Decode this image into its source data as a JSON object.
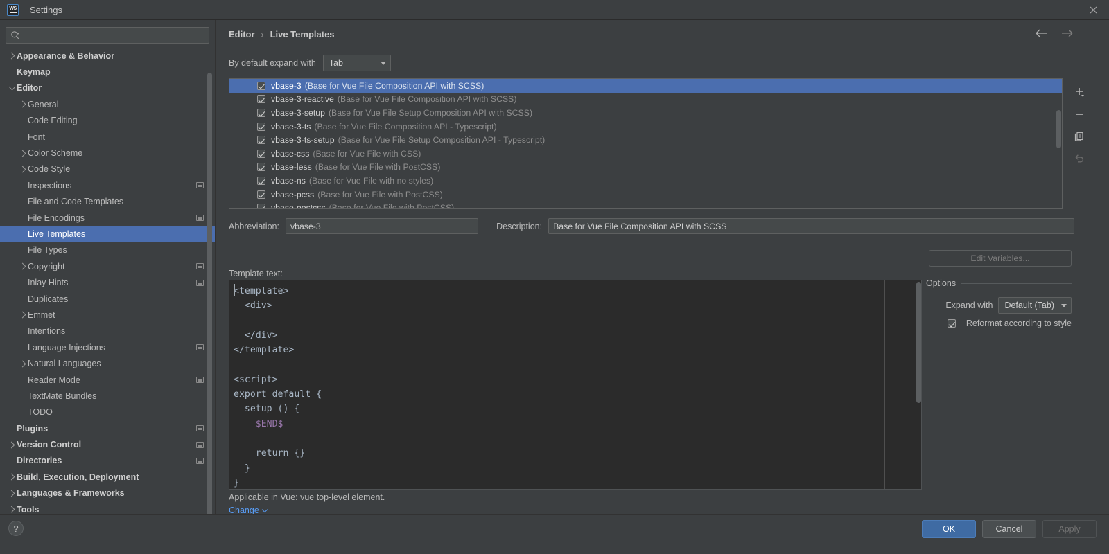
{
  "window": {
    "title": "Settings",
    "logo_text": "WS",
    "close_icon": "close-icon"
  },
  "search": {
    "placeholder": "",
    "value": "",
    "icon": "search-icon"
  },
  "sidebar": {
    "items": [
      {
        "label": "Appearance & Behavior",
        "level": 0,
        "arrow": "right",
        "bold": true,
        "mark": false,
        "selected": false
      },
      {
        "label": "Keymap",
        "level": 0,
        "arrow": "none",
        "bold": true,
        "mark": false,
        "selected": false
      },
      {
        "label": "Editor",
        "level": 0,
        "arrow": "down",
        "bold": true,
        "mark": false,
        "selected": false
      },
      {
        "label": "General",
        "level": 1,
        "arrow": "right",
        "bold": false,
        "mark": false,
        "selected": false
      },
      {
        "label": "Code Editing",
        "level": 1,
        "arrow": "none",
        "bold": false,
        "mark": false,
        "selected": false
      },
      {
        "label": "Font",
        "level": 1,
        "arrow": "none",
        "bold": false,
        "mark": false,
        "selected": false
      },
      {
        "label": "Color Scheme",
        "level": 1,
        "arrow": "right",
        "bold": false,
        "mark": false,
        "selected": false
      },
      {
        "label": "Code Style",
        "level": 1,
        "arrow": "right",
        "bold": false,
        "mark": false,
        "selected": false
      },
      {
        "label": "Inspections",
        "level": 1,
        "arrow": "none",
        "bold": false,
        "mark": true,
        "selected": false
      },
      {
        "label": "File and Code Templates",
        "level": 1,
        "arrow": "none",
        "bold": false,
        "mark": false,
        "selected": false
      },
      {
        "label": "File Encodings",
        "level": 1,
        "arrow": "none",
        "bold": false,
        "mark": true,
        "selected": false
      },
      {
        "label": "Live Templates",
        "level": 1,
        "arrow": "none",
        "bold": false,
        "mark": false,
        "selected": true
      },
      {
        "label": "File Types",
        "level": 1,
        "arrow": "none",
        "bold": false,
        "mark": false,
        "selected": false
      },
      {
        "label": "Copyright",
        "level": 1,
        "arrow": "right",
        "bold": false,
        "mark": true,
        "selected": false
      },
      {
        "label": "Inlay Hints",
        "level": 1,
        "arrow": "none",
        "bold": false,
        "mark": true,
        "selected": false
      },
      {
        "label": "Duplicates",
        "level": 1,
        "arrow": "none",
        "bold": false,
        "mark": false,
        "selected": false
      },
      {
        "label": "Emmet",
        "level": 1,
        "arrow": "right",
        "bold": false,
        "mark": false,
        "selected": false
      },
      {
        "label": "Intentions",
        "level": 1,
        "arrow": "none",
        "bold": false,
        "mark": false,
        "selected": false
      },
      {
        "label": "Language Injections",
        "level": 1,
        "arrow": "none",
        "bold": false,
        "mark": true,
        "selected": false
      },
      {
        "label": "Natural Languages",
        "level": 1,
        "arrow": "right",
        "bold": false,
        "mark": false,
        "selected": false
      },
      {
        "label": "Reader Mode",
        "level": 1,
        "arrow": "none",
        "bold": false,
        "mark": true,
        "selected": false
      },
      {
        "label": "TextMate Bundles",
        "level": 1,
        "arrow": "none",
        "bold": false,
        "mark": false,
        "selected": false
      },
      {
        "label": "TODO",
        "level": 1,
        "arrow": "none",
        "bold": false,
        "mark": false,
        "selected": false
      },
      {
        "label": "Plugins",
        "level": 0,
        "arrow": "none",
        "bold": true,
        "mark": true,
        "selected": false
      },
      {
        "label": "Version Control",
        "level": 0,
        "arrow": "right",
        "bold": true,
        "mark": true,
        "selected": false
      },
      {
        "label": "Directories",
        "level": 0,
        "arrow": "none",
        "bold": true,
        "mark": true,
        "selected": false
      },
      {
        "label": "Build, Execution, Deployment",
        "level": 0,
        "arrow": "right",
        "bold": true,
        "mark": false,
        "selected": false
      },
      {
        "label": "Languages & Frameworks",
        "level": 0,
        "arrow": "right",
        "bold": true,
        "mark": false,
        "selected": false
      },
      {
        "label": "Tools",
        "level": 0,
        "arrow": "right",
        "bold": true,
        "mark": false,
        "selected": false
      }
    ]
  },
  "breadcrumb": {
    "parent": "Editor",
    "separator": "›",
    "current": "Live Templates"
  },
  "nav": {
    "back_icon": "arrow-left-icon",
    "forward_icon": "arrow-right-icon"
  },
  "expand": {
    "label": "By default expand with",
    "value": "Tab"
  },
  "templates": {
    "rows": [
      {
        "abbr": "vbase-3",
        "desc": "(Base for Vue File Composition API with SCSS)",
        "checked": true,
        "selected": true
      },
      {
        "abbr": "vbase-3-reactive",
        "desc": "(Base for Vue File Composition API with SCSS)",
        "checked": true,
        "selected": false
      },
      {
        "abbr": "vbase-3-setup",
        "desc": "(Base for Vue File Setup Composition API with SCSS)",
        "checked": true,
        "selected": false
      },
      {
        "abbr": "vbase-3-ts",
        "desc": "(Base for Vue File Composition API - Typescript)",
        "checked": true,
        "selected": false
      },
      {
        "abbr": "vbase-3-ts-setup",
        "desc": "(Base for Vue File Setup Composition API - Typescript)",
        "checked": true,
        "selected": false
      },
      {
        "abbr": "vbase-css",
        "desc": "(Base for Vue File with CSS)",
        "checked": true,
        "selected": false
      },
      {
        "abbr": "vbase-less",
        "desc": "(Base for Vue File with PostCSS)",
        "checked": true,
        "selected": false
      },
      {
        "abbr": "vbase-ns",
        "desc": "(Base for Vue File with no styles)",
        "checked": true,
        "selected": false
      },
      {
        "abbr": "vbase-pcss",
        "desc": "(Base for Vue File with PostCSS)",
        "checked": true,
        "selected": false
      },
      {
        "abbr": "vbase-postcss",
        "desc": "(Base for Vue File with PostCSS)",
        "checked": true,
        "selected": false
      }
    ],
    "tools": [
      {
        "name": "add-template-button",
        "icon": "plus-icon",
        "enabled": true
      },
      {
        "name": "remove-template-button",
        "icon": "minus-icon",
        "enabled": true
      },
      {
        "name": "duplicate-template-button",
        "icon": "copy-icon",
        "enabled": true
      },
      {
        "name": "revert-template-button",
        "icon": "undo-arrow-icon",
        "enabled": false
      }
    ]
  },
  "details": {
    "abbreviation_label": "Abbreviation:",
    "abbreviation_value": "vbase-3",
    "description_label": "Description:",
    "description_value": "Base for Vue File Composition API with SCSS",
    "template_text_label": "Template text:",
    "template_code_before": "<template>\n  <div>\n\n  </div>\n</template>\n\n<script>\nexport default {\n  setup () {\n    ",
    "template_code_end": "$END$",
    "template_code_after": "\n\n    return {}\n  }\n}",
    "applicable_text": "Applicable in Vue: vue top-level element.",
    "change_link": "Change"
  },
  "options": {
    "edit_variables_label": "Edit Variables...",
    "section_title": "Options",
    "expand_with_label": "Expand with",
    "expand_with_value": "Default (Tab)",
    "reformat_label": "Reformat according to style",
    "reformat_checked": true
  },
  "footer": {
    "help_label": "?",
    "ok_label": "OK",
    "cancel_label": "Cancel",
    "apply_label": "Apply"
  },
  "colors": {
    "accent_selection": "#4b6eaf",
    "link": "#589df6",
    "primary_button": "#3f6ba3",
    "editor_bg": "#2b2b2b",
    "variable_token": "#9876aa"
  }
}
